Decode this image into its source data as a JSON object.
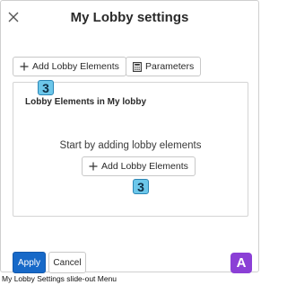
{
  "panel": {
    "title": "My Lobby settings",
    "close_icon": "close-icon"
  },
  "toolbar": {
    "add_lobby_elements_label": "Add Lobby Elements",
    "add_icon": "plus-icon",
    "parameters_label": "Parameters",
    "parameters_icon": "calculator-icon"
  },
  "callouts": {
    "toolbar_badge": "3",
    "content_badge": "3",
    "corner_badge": "A"
  },
  "content": {
    "section_title": "Lobby Elements in My lobby",
    "empty_message": "Start by adding lobby elements",
    "add_button_label": "Add Lobby Elements"
  },
  "footer": {
    "apply_label": "Apply",
    "cancel_label": "Cancel"
  },
  "caption": "My Lobby Settings slide-out Menu",
  "colors": {
    "primary": "#1769c8",
    "callout_fill": "#6cc7ea",
    "callout_border": "#2b86b5",
    "corner_badge": "#8b3fd6"
  }
}
